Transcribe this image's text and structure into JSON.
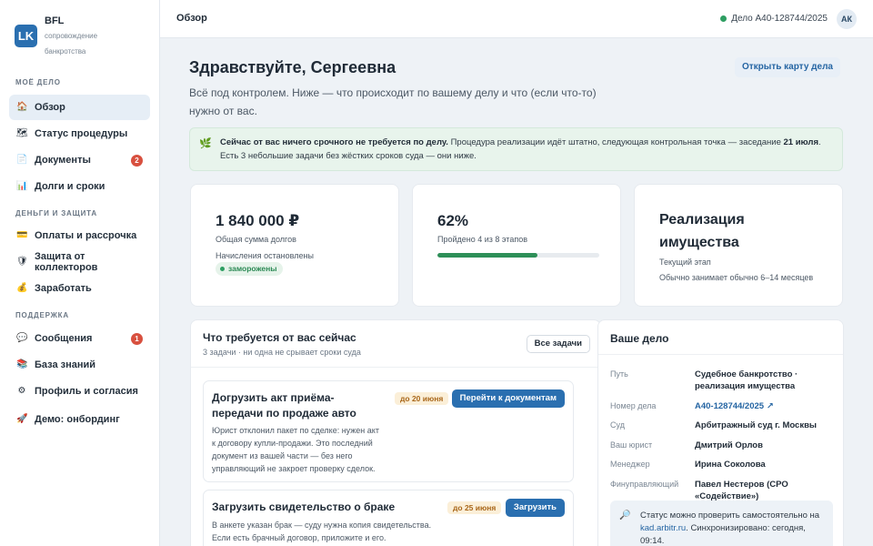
{
  "brand": {
    "logo": "LK",
    "name": "BFL",
    "subtitle": "сопровождение банкротства"
  },
  "sidebar": {
    "sections": [
      {
        "label": "МОЁ ДЕЛО"
      },
      {
        "label": "ДЕНЬГИ И ЗАЩИТА"
      },
      {
        "label": "ПОДДЕРЖКА"
      }
    ],
    "items": [
      {
        "label": "Обзор",
        "icon": "house-icon",
        "glyph": "🏠"
      },
      {
        "label": "Статус процедуры",
        "icon": "map-icon",
        "glyph": "🗺"
      },
      {
        "label": "Документы",
        "icon": "document-icon",
        "glyph": "📄",
        "badge": "2"
      },
      {
        "label": "Долги и сроки",
        "icon": "chart-icon",
        "glyph": "📊"
      },
      {
        "label": "Оплаты и рассрочка",
        "icon": "card-icon",
        "glyph": "💳"
      },
      {
        "label": "Защита от коллекторов",
        "icon": "shield-icon",
        "glyph": "🛡"
      },
      {
        "label": "Заработать",
        "icon": "moneybag-icon",
        "glyph": "💰"
      },
      {
        "label": "Сообщения",
        "icon": "chat-icon",
        "glyph": "💬",
        "badge": "1"
      },
      {
        "label": "База знаний",
        "icon": "books-icon",
        "glyph": "📚"
      },
      {
        "label": "Профиль и согласия",
        "icon": "gear-icon",
        "glyph": "⚙"
      },
      {
        "label": "Демо: онбординг",
        "icon": "rocket-icon",
        "glyph": "🚀"
      }
    ]
  },
  "topbar": {
    "title": "Обзор",
    "case_ref": "Дело А40-128744/2025",
    "avatar": "АК"
  },
  "main": {
    "greeting": "Здравствуйте, Сергеевна",
    "open_card": "Открыть карту дела",
    "lead": "Всё под контролем. Ниже — что происходит по вашему делу и что (если что-то) нужно от вас.",
    "notice": {
      "icon": "🌿",
      "bold": "Сейчас от вас ничего срочного не требуется по делу.",
      "text1": " Процедура реализации идёт штатно, следующая контрольная точка — заседание ",
      "date": "21 июля",
      "text2": ". Есть 3 небольшие задачи без жёстких сроков суда — они ниже."
    },
    "stats": {
      "debt": {
        "value": "1 840 000 ₽",
        "caption": "Общая сумма долгов",
        "note": "Начисления остановлены",
        "pill": "заморожены"
      },
      "progress": {
        "value": "62%",
        "caption": "Пройдено 4 из 8 этапов",
        "fraction": 0.62
      },
      "stage": {
        "value": "Реализация имущества",
        "caption": "Текущий этап",
        "note": "Обычно занимает обычно 6–14 месяцев"
      }
    },
    "tasks": {
      "title": "Что требуется от вас сейчас",
      "subtitle": "3 задачи · ни одна не срывает сроки суда",
      "all_button": "Все задачи",
      "items": [
        {
          "title": "Догрузить акт приёма-передачи по продаже авто",
          "due": "до 20 июня",
          "action": "Перейти к документам",
          "desc": [
            "Юрист отклонил пакет по сделке: нужен акт",
            "к договору купли-продажи. Это последний",
            "документ из вашей части — без него",
            "управляющий не закроет проверку сделок."
          ]
        },
        {
          "title": "Загрузить свидетельство о браке",
          "due": "до 25 июня",
          "action": "Загрузить",
          "desc": [
            "В анкете указан брак — суду нужна копия свидетельства.",
            "Если есть брачный договор, приложите и его."
          ]
        }
      ]
    },
    "case": {
      "title": "Ваше дело",
      "rows": [
        {
          "label": "Путь",
          "value": "Судебное банкротство · реализация имущества"
        },
        {
          "label": "Номер дела",
          "value": "А40-128744/2025 ↗"
        },
        {
          "label": "Суд",
          "value": "Арбитражный суд г. Москвы"
        },
        {
          "label": "Ваш юрист",
          "value": "Дмитрий Орлов"
        },
        {
          "label": "Менеджер",
          "value": "Ирина Соколова"
        },
        {
          "label": "Финуправляющий",
          "value": "Павел Нестеров (СРО «Содействие»)"
        }
      ],
      "info": {
        "icon": "🔎",
        "text1": "Статус можно проверить самостоятельно на ",
        "link": "kad.arbitr.ru",
        "text2": ". Синхронизировано: сегодня, 09:14."
      }
    }
  },
  "colors": {
    "accent": "#2a6fb0",
    "success": "#2e8f58",
    "danger": "#d8503f",
    "warning_bg": "#fbefd8"
  }
}
